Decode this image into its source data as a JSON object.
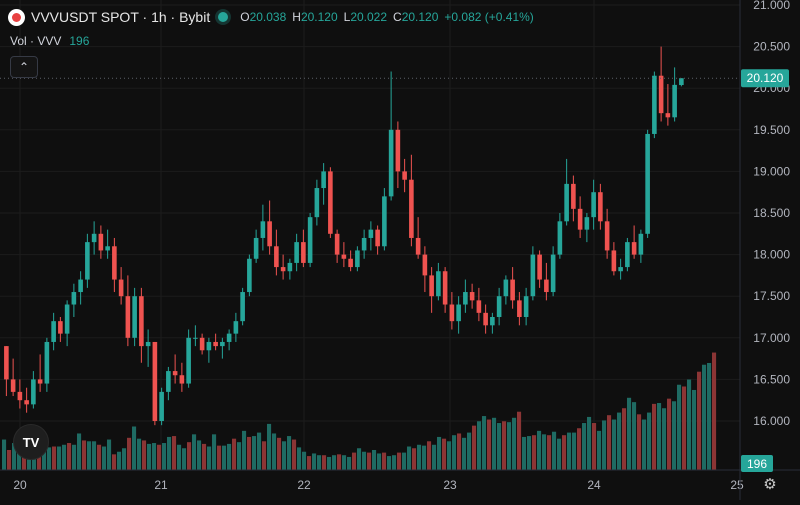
{
  "header": {
    "symbol_title": "VVVUSDT SPOT · 1h · Bybit",
    "ohlc": {
      "o_label": "O",
      "o": "20.038",
      "h_label": "H",
      "h": "20.120",
      "l_label": "L",
      "l": "20.022",
      "c_label": "C",
      "c": "20.120",
      "change": "+0.082 (+0.41%)"
    }
  },
  "volume_legend": {
    "label": "Vol · VVV",
    "value": "196"
  },
  "icons": {
    "exchange_logo": "bybit-logo-icon",
    "live": "live-dot-icon",
    "collapse": "chevron-up-icon",
    "tv_logo": "tradingview-logo-icon",
    "settings": "gear-icon"
  },
  "colors": {
    "up": "#26a69a",
    "down": "#ef5350",
    "up_volume": "#1f6b63",
    "down_volume": "#8b3535",
    "background": "#0f0f0f",
    "grid": "#1c1c1c",
    "last_price_label": "#26a69a"
  },
  "chart_data": {
    "type": "candlestick",
    "title": "VVVUSDT SPOT · 1h · Bybit",
    "y_axis": {
      "side": "right",
      "ylim": [
        15.45,
        21.0
      ],
      "ticks": [
        "21.000",
        "20.500",
        "20.000",
        "19.500",
        "19.000",
        "18.500",
        "18.000",
        "17.500",
        "17.000",
        "16.500",
        "16.000"
      ]
    },
    "x_axis": {
      "ticks": [
        "20",
        "21",
        "22",
        "23",
        "24",
        "25"
      ]
    },
    "grid": true,
    "last_price": "20.120",
    "last_volume": "196",
    "candles": [
      [
        16.9,
        16.9,
        16.3,
        16.5
      ],
      [
        16.5,
        16.75,
        16.3,
        16.35
      ],
      [
        16.35,
        16.5,
        16.15,
        16.25
      ],
      [
        16.25,
        16.4,
        16.1,
        16.2
      ],
      [
        16.2,
        16.6,
        16.15,
        16.5
      ],
      [
        16.5,
        16.8,
        16.35,
        16.45
      ],
      [
        16.45,
        17.0,
        16.35,
        16.95
      ],
      [
        16.95,
        17.3,
        16.85,
        17.2
      ],
      [
        17.2,
        17.25,
        16.95,
        17.05
      ],
      [
        17.05,
        17.45,
        16.9,
        17.4
      ],
      [
        17.4,
        17.65,
        17.25,
        17.55
      ],
      [
        17.55,
        17.8,
        17.4,
        17.7
      ],
      [
        17.7,
        18.25,
        17.6,
        18.15
      ],
      [
        18.15,
        18.4,
        18.0,
        18.25
      ],
      [
        18.25,
        18.35,
        17.95,
        18.05
      ],
      [
        18.05,
        18.3,
        17.95,
        18.1
      ],
      [
        18.1,
        18.2,
        17.55,
        17.7
      ],
      [
        17.7,
        17.85,
        17.4,
        17.5
      ],
      [
        17.5,
        17.75,
        16.9,
        17.0
      ],
      [
        17.0,
        17.6,
        16.9,
        17.5
      ],
      [
        17.5,
        17.6,
        16.7,
        16.9
      ],
      [
        16.9,
        17.1,
        16.65,
        16.95
      ],
      [
        16.95,
        16.95,
        15.95,
        16.0
      ],
      [
        16.0,
        16.4,
        15.95,
        16.35
      ],
      [
        16.35,
        16.65,
        16.25,
        16.6
      ],
      [
        16.6,
        16.8,
        16.45,
        16.55
      ],
      [
        16.55,
        16.7,
        16.35,
        16.45
      ],
      [
        16.45,
        17.1,
        16.4,
        17.0
      ],
      [
        17.0,
        17.15,
        16.9,
        17.0
      ],
      [
        17.0,
        17.05,
        16.8,
        16.85
      ],
      [
        16.85,
        17.0,
        16.7,
        16.95
      ],
      [
        16.95,
        17.05,
        16.85,
        16.9
      ],
      [
        16.9,
        17.0,
        16.75,
        16.95
      ],
      [
        16.95,
        17.1,
        16.85,
        17.05
      ],
      [
        17.05,
        17.3,
        16.95,
        17.2
      ],
      [
        17.2,
        17.6,
        17.15,
        17.55
      ],
      [
        17.55,
        18.0,
        17.5,
        17.95
      ],
      [
        17.95,
        18.3,
        17.9,
        18.2
      ],
      [
        18.2,
        18.6,
        18.05,
        18.4
      ],
      [
        18.4,
        18.65,
        18.0,
        18.1
      ],
      [
        18.1,
        18.3,
        17.75,
        17.85
      ],
      [
        17.85,
        18.0,
        17.7,
        17.8
      ],
      [
        17.8,
        17.95,
        17.7,
        17.9
      ],
      [
        17.9,
        18.25,
        17.8,
        18.15
      ],
      [
        18.15,
        18.3,
        17.85,
        17.9
      ],
      [
        17.9,
        18.5,
        17.85,
        18.45
      ],
      [
        18.45,
        18.9,
        18.35,
        18.8
      ],
      [
        18.8,
        19.1,
        18.6,
        19.0
      ],
      [
        19.0,
        19.05,
        18.2,
        18.25
      ],
      [
        18.25,
        18.3,
        17.9,
        18.0
      ],
      [
        18.0,
        18.15,
        17.85,
        17.95
      ],
      [
        17.95,
        18.05,
        17.8,
        17.85
      ],
      [
        17.85,
        18.1,
        17.8,
        18.05
      ],
      [
        18.05,
        18.3,
        17.95,
        18.2
      ],
      [
        18.2,
        18.4,
        18.05,
        18.3
      ],
      [
        18.3,
        18.35,
        18.0,
        18.1
      ],
      [
        18.1,
        18.8,
        18.05,
        18.7
      ],
      [
        18.7,
        20.2,
        18.65,
        19.5
      ],
      [
        19.5,
        19.6,
        18.8,
        19.0
      ],
      [
        19.0,
        19.15,
        18.75,
        18.9
      ],
      [
        18.9,
        19.2,
        18.1,
        18.2
      ],
      [
        18.2,
        18.45,
        17.95,
        18.0
      ],
      [
        18.0,
        18.1,
        17.55,
        17.75
      ],
      [
        17.75,
        17.85,
        17.3,
        17.5
      ],
      [
        17.5,
        17.9,
        17.45,
        17.8
      ],
      [
        17.8,
        17.85,
        17.3,
        17.4
      ],
      [
        17.4,
        17.55,
        17.1,
        17.2
      ],
      [
        17.2,
        17.5,
        17.05,
        17.4
      ],
      [
        17.4,
        17.7,
        17.3,
        17.55
      ],
      [
        17.55,
        17.65,
        17.35,
        17.45
      ],
      [
        17.45,
        17.6,
        17.2,
        17.3
      ],
      [
        17.3,
        17.4,
        17.05,
        17.15
      ],
      [
        17.15,
        17.3,
        17.05,
        17.25
      ],
      [
        17.25,
        17.6,
        17.15,
        17.5
      ],
      [
        17.5,
        17.75,
        17.4,
        17.7
      ],
      [
        17.7,
        17.85,
        17.35,
        17.45
      ],
      [
        17.45,
        17.55,
        17.15,
        17.25
      ],
      [
        17.25,
        17.6,
        17.15,
        17.5
      ],
      [
        17.5,
        18.1,
        17.45,
        18.0
      ],
      [
        18.0,
        18.05,
        17.6,
        17.7
      ],
      [
        17.7,
        17.9,
        17.45,
        17.55
      ],
      [
        17.55,
        18.1,
        17.5,
        18.0
      ],
      [
        18.0,
        18.5,
        17.95,
        18.4
      ],
      [
        18.4,
        19.15,
        18.35,
        18.85
      ],
      [
        18.85,
        18.95,
        18.4,
        18.55
      ],
      [
        18.55,
        18.7,
        18.2,
        18.3
      ],
      [
        18.3,
        18.5,
        18.15,
        18.45
      ],
      [
        18.45,
        18.9,
        18.3,
        18.75
      ],
      [
        18.75,
        18.85,
        18.3,
        18.4
      ],
      [
        18.4,
        18.55,
        17.95,
        18.05
      ],
      [
        18.05,
        18.15,
        17.75,
        17.8
      ],
      [
        17.8,
        17.95,
        17.7,
        17.85
      ],
      [
        17.85,
        18.2,
        17.8,
        18.15
      ],
      [
        18.15,
        18.35,
        17.95,
        18.0
      ],
      [
        18.0,
        18.3,
        17.9,
        18.25
      ],
      [
        18.25,
        19.5,
        18.2,
        19.45
      ],
      [
        19.45,
        20.2,
        19.4,
        20.15
      ],
      [
        20.15,
        20.5,
        19.6,
        19.7
      ],
      [
        19.7,
        20.05,
        19.55,
        19.65
      ],
      [
        19.65,
        20.25,
        19.6,
        20.04
      ],
      [
        20.038,
        20.12,
        20.022,
        20.12
      ]
    ],
    "volumes": [
      35,
      23,
      31,
      24,
      22,
      22,
      25,
      24,
      25,
      26,
      27,
      27,
      29,
      31,
      29,
      42,
      34,
      33,
      33,
      29,
      27,
      35,
      18,
      21,
      25,
      37,
      50,
      36,
      34,
      30,
      31,
      29,
      31,
      38,
      39,
      29,
      25,
      32,
      41,
      34,
      30,
      27,
      41,
      28,
      28,
      30,
      36,
      32,
      45,
      38,
      39,
      43,
      33,
      53,
      42,
      37,
      33,
      39,
      35,
      26,
      21,
      16,
      19,
      17,
      17,
      15,
      17,
      18,
      17,
      15,
      20,
      25,
      21,
      20,
      23,
      19,
      20,
      16,
      17,
      20,
      20,
      27,
      25,
      29,
      28,
      33,
      29,
      38,
      36,
      33,
      40,
      42,
      37,
      43,
      51,
      56,
      62,
      58,
      60,
      54,
      56,
      55,
      60,
      67,
      38,
      39,
      40,
      45,
      41,
      40,
      44,
      36,
      40,
      43,
      43,
      48,
      54,
      61,
      54,
      45,
      57,
      63,
      58,
      66,
      71,
      83,
      78,
      64,
      58,
      66,
      76,
      77,
      71,
      82,
      79,
      98,
      96,
      104,
      92,
      113,
      121,
      123,
      135
    ]
  }
}
